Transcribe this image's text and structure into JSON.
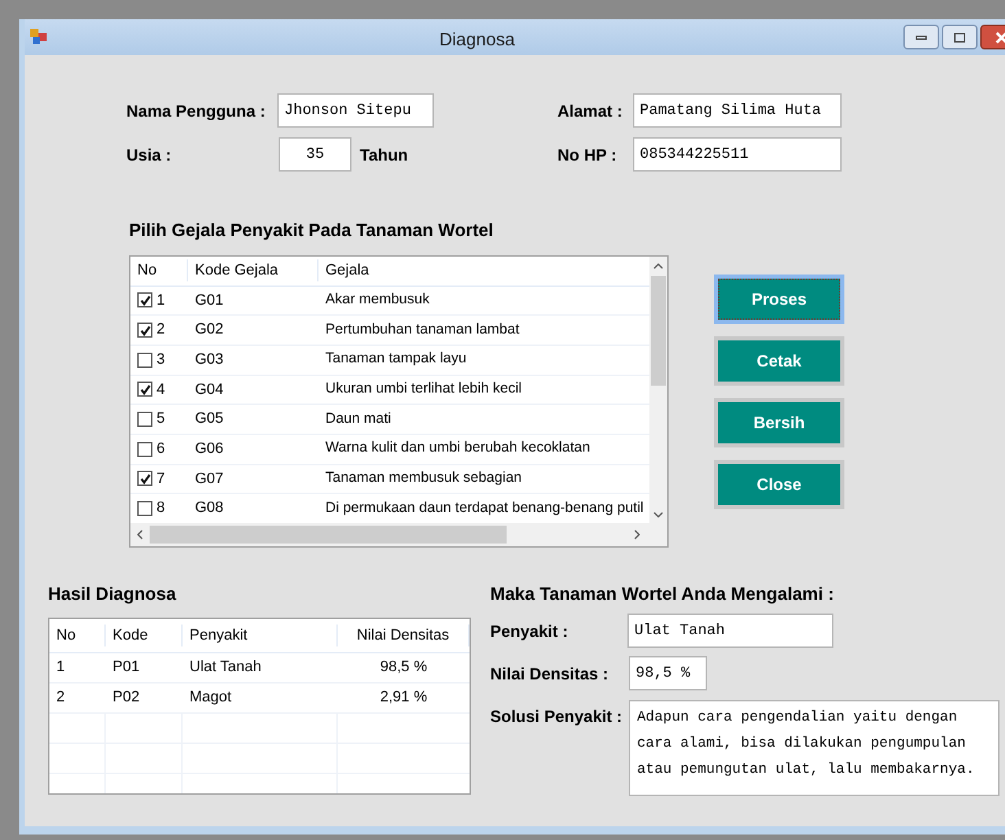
{
  "window": {
    "title": "Diagnosa"
  },
  "user": {
    "name_label": "Nama Pengguna :",
    "name": "Jhonson Sitepu",
    "age_label": "Usia :",
    "age": "35",
    "age_unit": "Tahun",
    "address_label": "Alamat :",
    "address": "Pamatang Silima Huta",
    "phone_label": "No HP :",
    "phone": "085344225511"
  },
  "symptoms": {
    "title": "Pilih Gejala Penyakit Pada Tanaman Wortel",
    "columns": [
      "No",
      "Kode Gejala",
      "Gejala"
    ],
    "rows": [
      {
        "no": "1",
        "code": "G01",
        "symptom": "Akar membusuk",
        "checked": true
      },
      {
        "no": "2",
        "code": "G02",
        "symptom": "Pertumbuhan tanaman lambat",
        "checked": true
      },
      {
        "no": "3",
        "code": "G03",
        "symptom": "Tanaman tampak layu",
        "checked": false
      },
      {
        "no": "4",
        "code": "G04",
        "symptom": "Ukuran umbi terlihat lebih kecil",
        "checked": true
      },
      {
        "no": "5",
        "code": "G05",
        "symptom": "Daun mati",
        "checked": false
      },
      {
        "no": "6",
        "code": "G06",
        "symptom": "Warna kulit dan umbi berubah kecoklatan",
        "checked": false
      },
      {
        "no": "7",
        "code": "G07",
        "symptom": "Tanaman membusuk sebagian",
        "checked": true
      },
      {
        "no": "8",
        "code": "G08",
        "symptom": "Di permukaan daun terdapat benang-benang putil",
        "checked": false
      }
    ]
  },
  "buttons": [
    {
      "label": "Proses",
      "focused": true
    },
    {
      "label": "Cetak",
      "focused": false
    },
    {
      "label": "Bersih",
      "focused": false
    },
    {
      "label": "Close",
      "focused": false
    }
  ],
  "results": {
    "title": "Hasil Diagnosa",
    "columns": [
      "No",
      "Kode",
      "Penyakit",
      "Nilai Densitas"
    ],
    "rows": [
      [
        "1",
        "P01",
        "Ulat Tanah",
        "98,5 %"
      ],
      [
        "2",
        "P02",
        "Magot",
        "2,91 %"
      ]
    ]
  },
  "conclusion": {
    "title": "Maka Tanaman Wortel Anda Mengalami :",
    "disease_label": "Penyakit :",
    "disease": "Ulat Tanah",
    "density_label": "Nilai Densitas :",
    "density": "98,5 %",
    "solution_label": "Solusi Penyakit :",
    "solution": "Adapun cara pengendalian yaitu dengan cara alami, bisa dilakukan pengumpulan atau pemungutan ulat, lalu membakarnya."
  }
}
